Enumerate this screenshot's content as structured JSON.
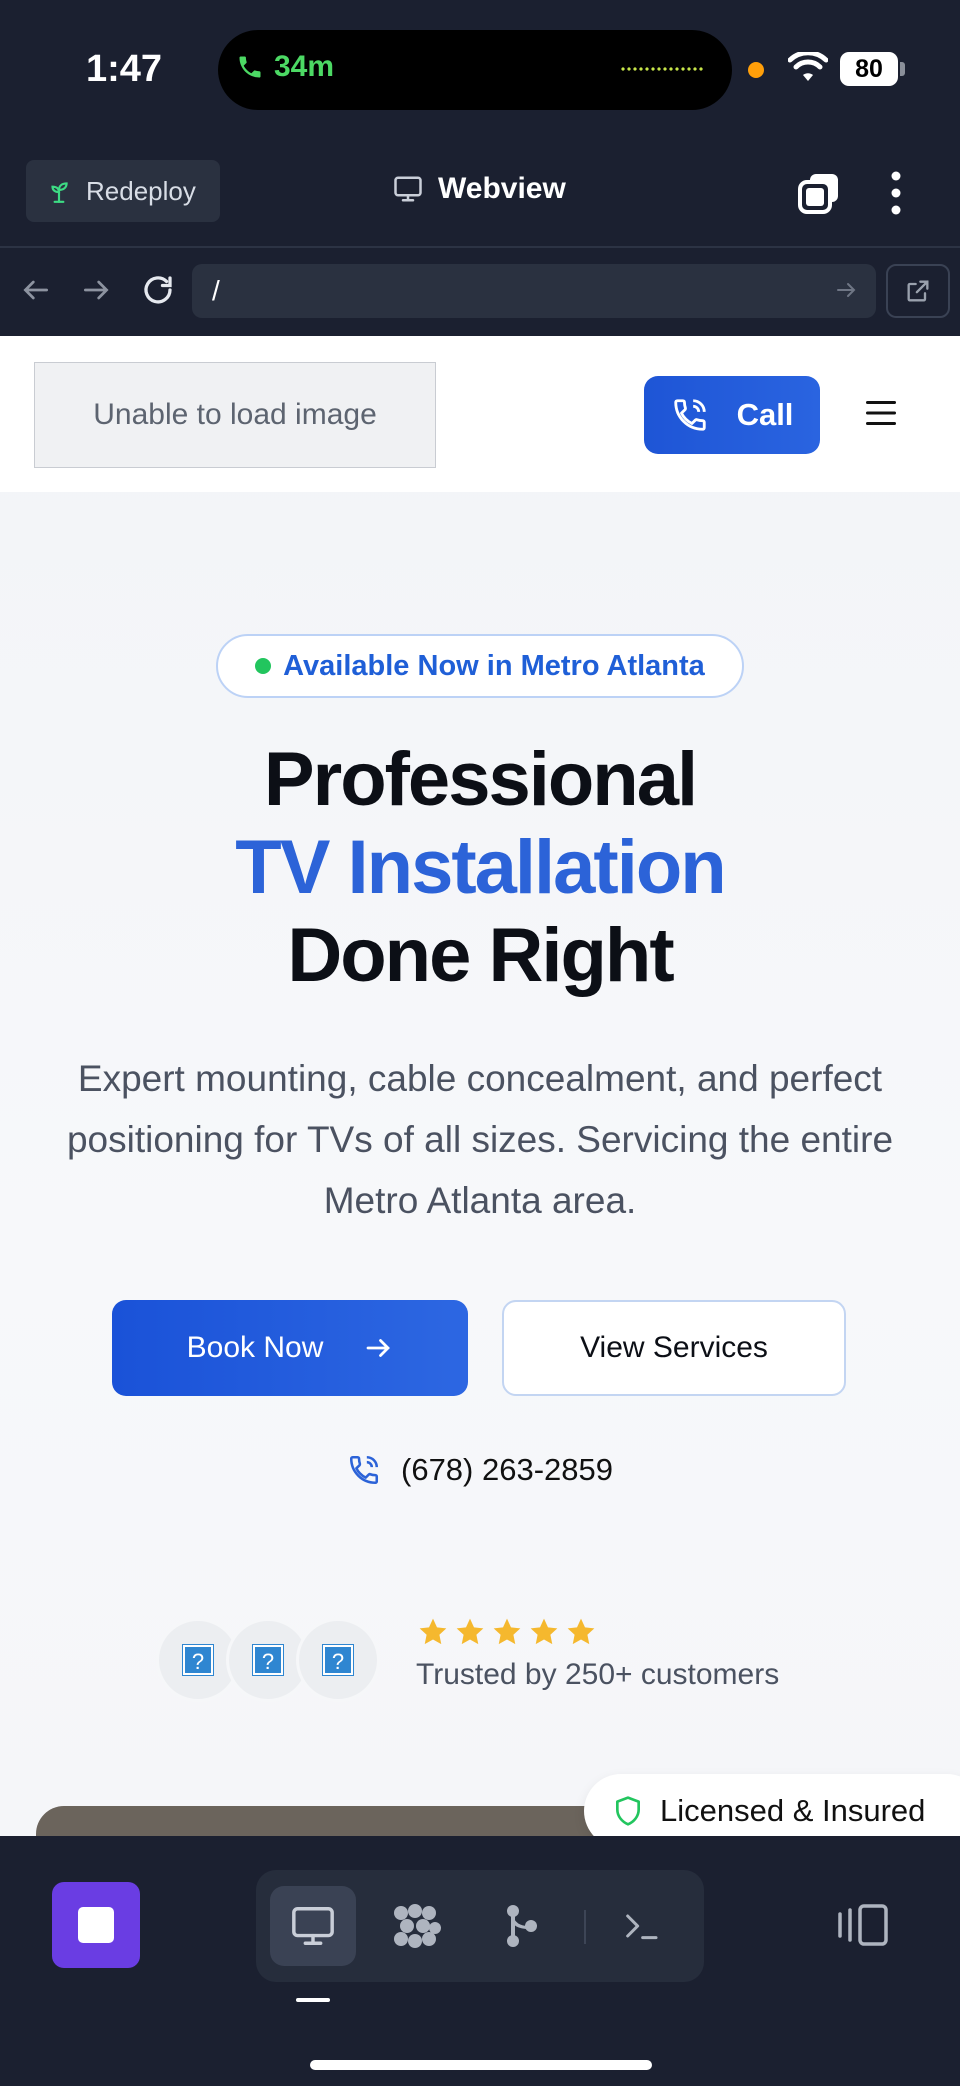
{
  "status_bar": {
    "time": "1:47",
    "call_duration": "34m",
    "battery": "80"
  },
  "toolbar": {
    "redeploy_label": "Redeploy",
    "title": "Webview"
  },
  "url_bar": {
    "value": "/"
  },
  "site": {
    "logo_alt_text": "Unable to load image",
    "call_label": "Call",
    "badge": "Available Now in Metro Atlanta",
    "headline_line1": "Professional",
    "headline_line2": "TV Installation",
    "headline_line3": "Done Right",
    "subtext": "Expert mounting, cable concealment, and perfect positioning for TVs of all sizes. Servicing the entire Metro Atlanta area.",
    "book_label": "Book Now",
    "services_label": "View Services",
    "phone": "(678) 263-2859",
    "rating_stars": 5,
    "trusted_text": "Trusted by 250+ customers",
    "licensed_label": "Licensed & Insured"
  },
  "colors": {
    "app_bg": "#1b2030",
    "brand_blue": "#2c63d8",
    "accent_purple": "#6a3de3",
    "star_yellow": "#f5b82e",
    "available_green": "#22c55e"
  },
  "icons": {
    "redeploy": "sprout-icon",
    "webview": "monitor-icon",
    "tabs": "tabs-icon",
    "more": "vertical-dots-icon",
    "back": "arrow-left-icon",
    "forward": "arrow-right-icon",
    "reload": "reload-icon",
    "external": "external-link-icon",
    "call": "phone-icon",
    "menu": "hamburger-icon",
    "licensed": "shield-icon"
  }
}
